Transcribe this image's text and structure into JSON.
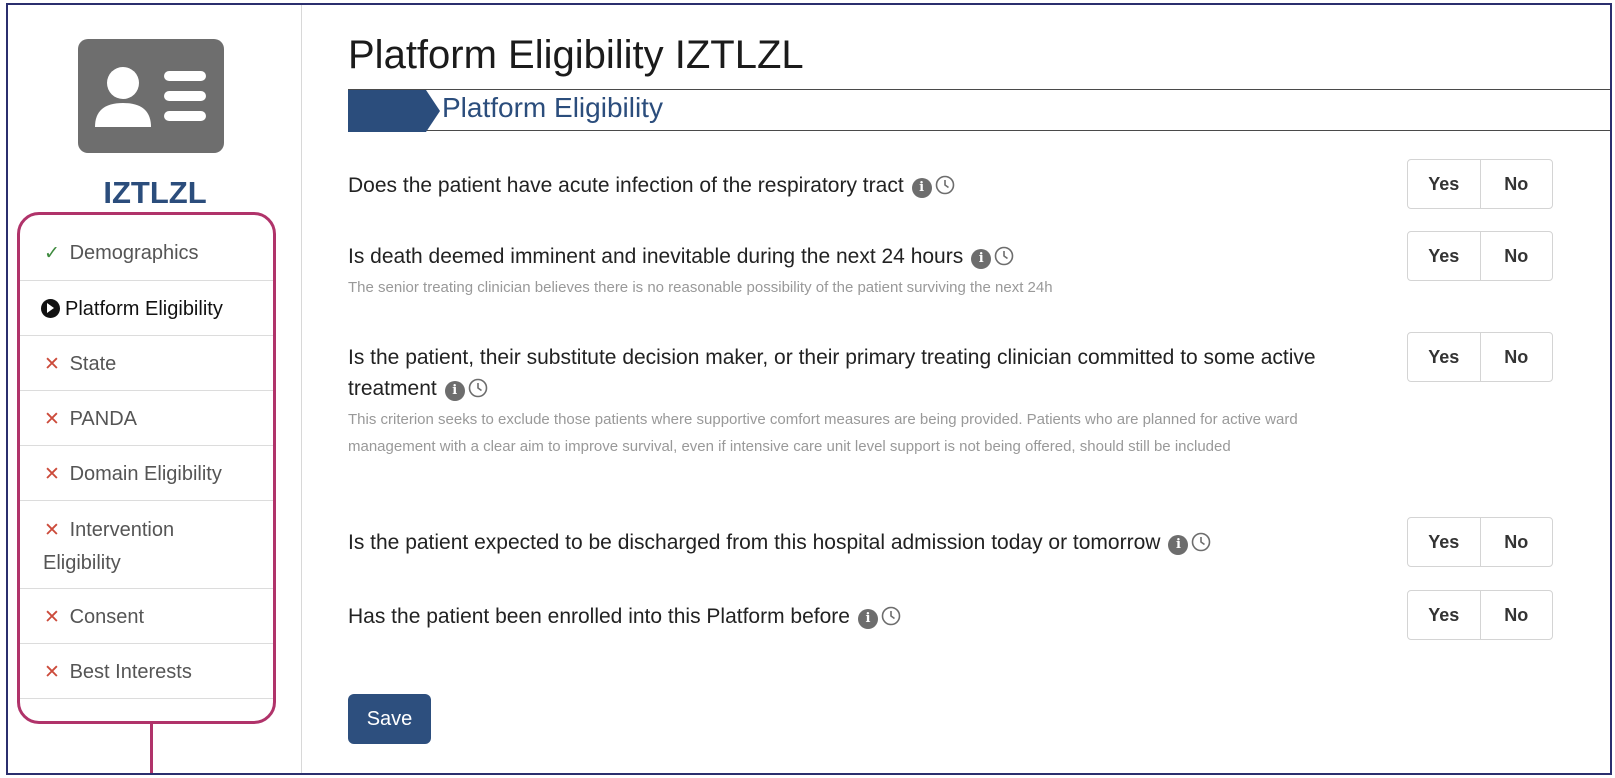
{
  "patient": {
    "id": "IZTLZL",
    "avatar_icon": "id-card-icon"
  },
  "sidebar": {
    "items": [
      {
        "label": "Demographics",
        "status": "complete",
        "icon": "check-icon"
      },
      {
        "label": "Platform Eligibility",
        "status": "current",
        "icon": "arrow-circle-icon"
      },
      {
        "label": "State",
        "status": "incomplete",
        "icon": "cross-icon"
      },
      {
        "label": "PANDA",
        "status": "incomplete",
        "icon": "cross-icon"
      },
      {
        "label": "Domain Eligibility",
        "status": "incomplete",
        "icon": "cross-icon"
      },
      {
        "label_line1": "Intervention",
        "label_line2": "Eligibility",
        "status": "incomplete",
        "icon": "cross-icon"
      },
      {
        "label": "Consent",
        "status": "incomplete",
        "icon": "cross-icon"
      },
      {
        "label": "Best Interests",
        "status": "incomplete",
        "icon": "cross-icon"
      }
    ],
    "marks": {
      "check": "✓",
      "cross": "✕"
    }
  },
  "main": {
    "title": "Platform Eligibility IZTLZL",
    "section_label": "Platform Eligibility",
    "questions": [
      {
        "text": "Does the patient have acute infection of the respiratory tract",
        "help": "",
        "yes": "Yes",
        "no": "No"
      },
      {
        "text": "Is death deemed imminent and inevitable during the next 24 hours",
        "help": "The senior treating clinician believes there is no reasonable possibility of the patient surviving the next 24h",
        "yes": "Yes",
        "no": "No"
      },
      {
        "text": "Is the patient, their substitute decision maker, or their primary treating clinician committed to some active treatment",
        "help": "This criterion seeks to exclude those patients where supportive comfort measures are being provided. Patients who are planned for active ward management with a clear aim to improve survival, even if intensive care unit level support is not being offered, should still be included",
        "yes": "Yes",
        "no": "No"
      },
      {
        "text": "Is the patient expected to be discharged from this hospital admission today or tomorrow",
        "help": "",
        "yes": "Yes",
        "no": "No"
      },
      {
        "text": "Has the patient been enrolled into this Platform before",
        "help": "",
        "yes": "Yes",
        "no": "No"
      }
    ],
    "save_label": "Save"
  },
  "colors": {
    "brand_blue": "#2b4d7c",
    "highlight_magenta": "#b0336a",
    "incomplete_red": "#cc4b3b",
    "complete_green": "#3e8a3e"
  }
}
